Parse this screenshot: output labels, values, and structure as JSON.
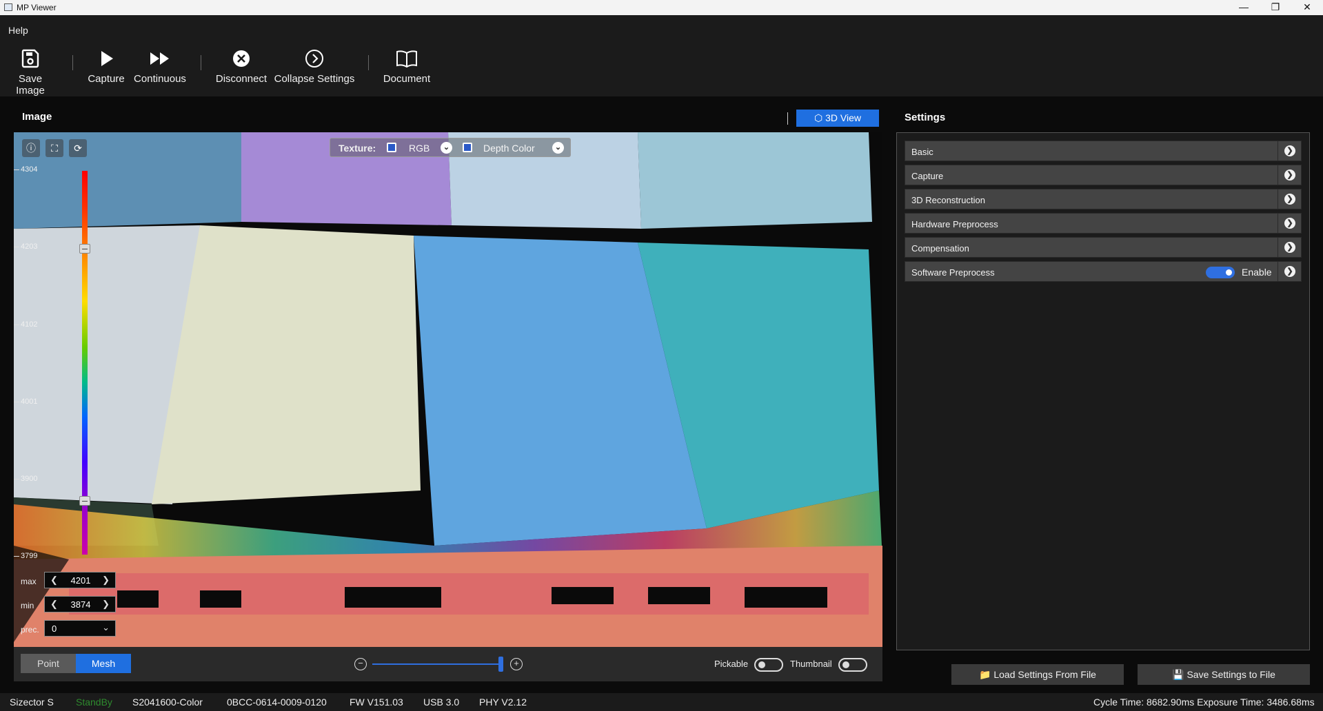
{
  "window": {
    "title": "MP Viewer",
    "minimize_icon": "minimize-icon",
    "maximize_icon": "restore-icon",
    "close_icon": "close-icon"
  },
  "menu": {
    "help": "Help"
  },
  "toolbar": {
    "save_image": "Save Image",
    "capture": "Capture",
    "continuous": "Continuous",
    "disconnect": "Disconnect",
    "collapse_settings": "Collapse Settings",
    "document": "Document"
  },
  "image_panel": {
    "title": "Image",
    "view_mode": "3D View",
    "texture": {
      "label": "Texture:",
      "option1": "RGB",
      "option2": "Depth Color"
    },
    "scale_ticks": [
      "4304",
      "4203",
      "4102",
      "4001",
      "3900",
      "3799"
    ],
    "range": {
      "max_label": "max",
      "max_value": "4201",
      "min_label": "min",
      "min_value": "3874",
      "prec_label": "prec.",
      "prec_value": "0"
    },
    "bottom": {
      "point": "Point",
      "mesh": "Mesh",
      "pickable": "Pickable",
      "thumbnail": "Thumbnail",
      "zoom_level": 1.0
    }
  },
  "settings": {
    "title": "Settings",
    "sections": [
      {
        "label": "Basic"
      },
      {
        "label": "Capture"
      },
      {
        "label": "3D Reconstruction"
      },
      {
        "label": "Hardware Preprocess"
      },
      {
        "label": "Compensation"
      },
      {
        "label": "Software Preprocess",
        "toggle_label": "Enable"
      }
    ],
    "load_button": "Load Settings From File",
    "save_button": "Save Settings to File"
  },
  "status": {
    "device": "Sizector S",
    "state": "StandBy",
    "serial": "S2041600-Color",
    "id": "0BCC-0614-0009-0120",
    "fw": "FW V151.03",
    "usb": "USB 3.0",
    "phy": "PHY V2.12",
    "timing": "Cycle Time: 8682.90ms Exposure Time: 3486.68ms"
  },
  "colors": {
    "accent": "#1f6fe0",
    "status_ok": "#2e8b2e"
  }
}
